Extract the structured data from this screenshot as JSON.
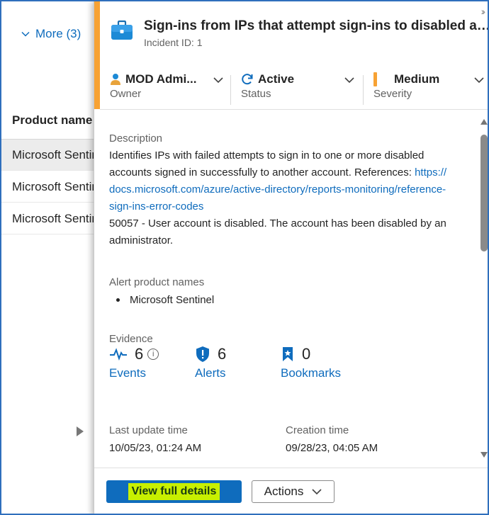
{
  "background": {
    "more_link": "More (3)",
    "column_header": "Product name",
    "rows": [
      "Microsoft Sentinel",
      "Microsoft Sentinel",
      "Microsoft Sentinel"
    ]
  },
  "panel": {
    "title": "Sign-ins from IPs that attempt sign-ins to disabled accounts",
    "incident_id": "Incident ID: 1",
    "owner": {
      "value": "MOD Admi...",
      "label": "Owner"
    },
    "status": {
      "value": "Active",
      "label": "Status"
    },
    "severity": {
      "value": "Medium",
      "label": "Severity"
    },
    "description_label": "Description",
    "description_text": "Identifies IPs with failed attempts to sign in to one or more disabled accounts signed in successfully to another account.",
    "references_label": "References: ",
    "references_link": "https://docs.microsoft.com/azure/active-directory/reports-monitoring/reference-sign-ins-error-codes",
    "error_text": "50057 - User account is disabled. The account has been disabled by an administrator.",
    "alert_products_label": "Alert product names",
    "alert_products": [
      "Microsoft Sentinel"
    ],
    "evidence_label": "Evidence",
    "evidence": {
      "events": {
        "count": "6",
        "label": "Events"
      },
      "alerts": {
        "count": "6",
        "label": "Alerts"
      },
      "bookmarks": {
        "count": "0",
        "label": "Bookmarks"
      }
    },
    "last_update_label": "Last update time",
    "last_update_value": "10/05/23, 01:24 AM",
    "creation_label": "Creation time",
    "creation_value": "09/28/23, 04:05 AM",
    "view_full_details": "View full details",
    "actions": "Actions"
  },
  "colors": {
    "accent": "#0f6cbd",
    "severity_medium": "#f7a234",
    "highlight": "#c8f000"
  },
  "icons": [
    "chevron-down-icon",
    "briefcase-icon",
    "person-icon",
    "refresh-icon",
    "info-icon",
    "pulse-icon",
    "shield-icon",
    "bookmark-icon",
    "double-chevron-right-icon"
  ]
}
